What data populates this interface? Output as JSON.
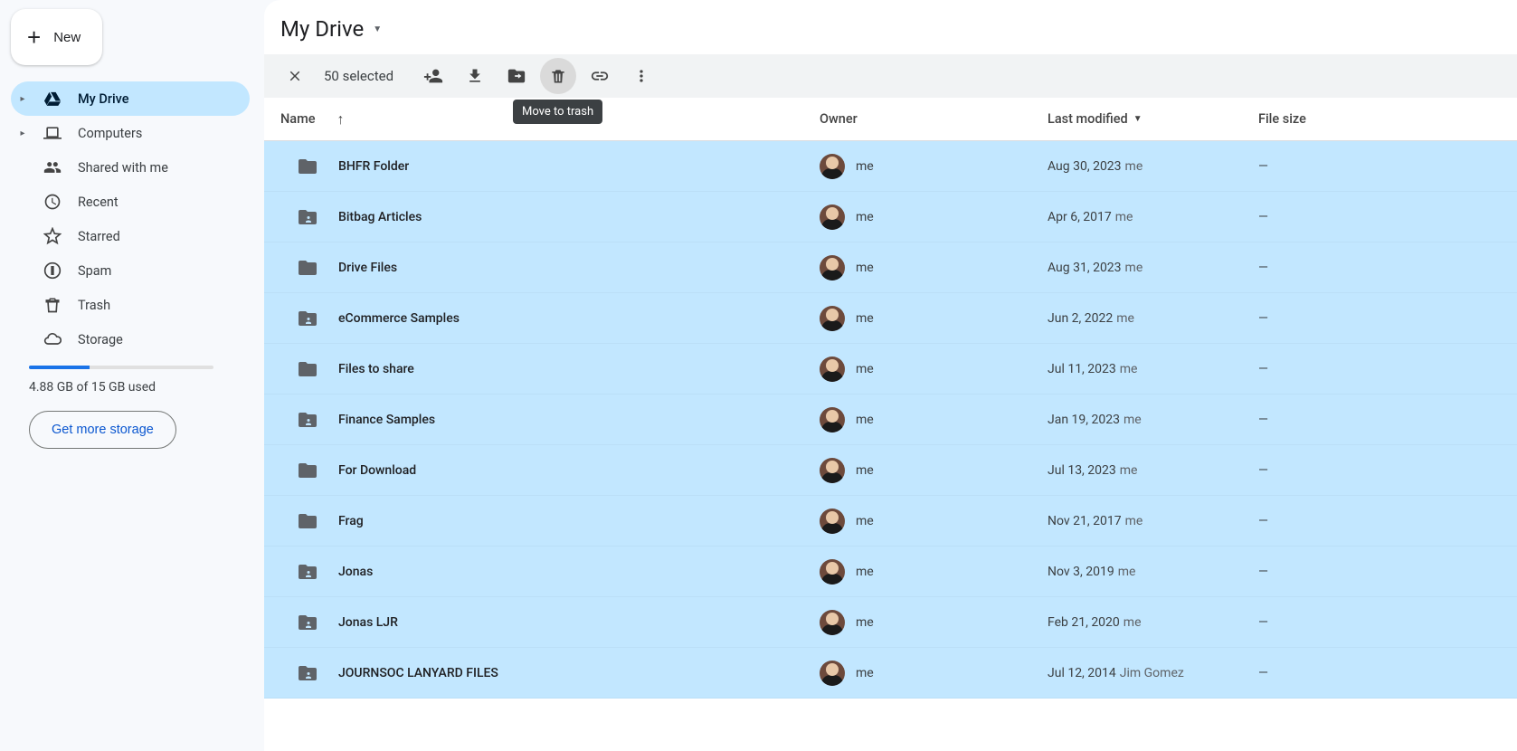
{
  "sidebar": {
    "new_label": "New",
    "items": [
      {
        "label": "My Drive",
        "icon": "drive",
        "expandable": true,
        "active": true
      },
      {
        "label": "Computers",
        "icon": "laptop",
        "expandable": true
      },
      {
        "label": "Shared with me",
        "icon": "people"
      },
      {
        "label": "Recent",
        "icon": "clock"
      },
      {
        "label": "Starred",
        "icon": "star"
      },
      {
        "label": "Spam",
        "icon": "spam"
      },
      {
        "label": "Trash",
        "icon": "trash"
      },
      {
        "label": "Storage",
        "icon": "cloud"
      }
    ],
    "storage_used_text": "4.88 GB of 15 GB used",
    "storage_percent": 33,
    "get_more_label": "Get more storage"
  },
  "header": {
    "title": "My Drive"
  },
  "actionbar": {
    "selected_text": "50 selected",
    "tooltip": "Move to trash"
  },
  "columns": {
    "name": "Name",
    "owner": "Owner",
    "modified": "Last modified",
    "size": "File size"
  },
  "files": [
    {
      "name": "BHFR Folder",
      "icon": "folder",
      "owner": "me",
      "modified": "Aug 30, 2023",
      "modified_by": "me",
      "size": "—"
    },
    {
      "name": "Bitbag Articles",
      "icon": "shared-folder",
      "owner": "me",
      "modified": "Apr 6, 2017",
      "modified_by": "me",
      "size": "—"
    },
    {
      "name": "Drive Files",
      "icon": "folder",
      "owner": "me",
      "modified": "Aug 31, 2023",
      "modified_by": "me",
      "size": "—"
    },
    {
      "name": "eCommerce Samples",
      "icon": "shared-folder",
      "owner": "me",
      "modified": "Jun 2, 2022",
      "modified_by": "me",
      "size": "—"
    },
    {
      "name": "Files to share",
      "icon": "folder",
      "owner": "me",
      "modified": "Jul 11, 2023",
      "modified_by": "me",
      "size": "—"
    },
    {
      "name": "Finance Samples",
      "icon": "shared-folder",
      "owner": "me",
      "modified": "Jan 19, 2023",
      "modified_by": "me",
      "size": "—"
    },
    {
      "name": "For Download",
      "icon": "folder",
      "owner": "me",
      "modified": "Jul 13, 2023",
      "modified_by": "me",
      "size": "—"
    },
    {
      "name": "Frag",
      "icon": "folder",
      "owner": "me",
      "modified": "Nov 21, 2017",
      "modified_by": "me",
      "size": "—"
    },
    {
      "name": "Jonas",
      "icon": "shared-folder",
      "owner": "me",
      "modified": "Nov 3, 2019",
      "modified_by": "me",
      "size": "—"
    },
    {
      "name": "Jonas LJR",
      "icon": "shared-folder",
      "owner": "me",
      "modified": "Feb 21, 2020",
      "modified_by": "me",
      "size": "—"
    },
    {
      "name": "JOURNSOC LANYARD FILES",
      "icon": "shared-folder",
      "owner": "me",
      "modified": "Jul 12, 2014",
      "modified_by": "Jim Gomez",
      "size": "—"
    }
  ]
}
